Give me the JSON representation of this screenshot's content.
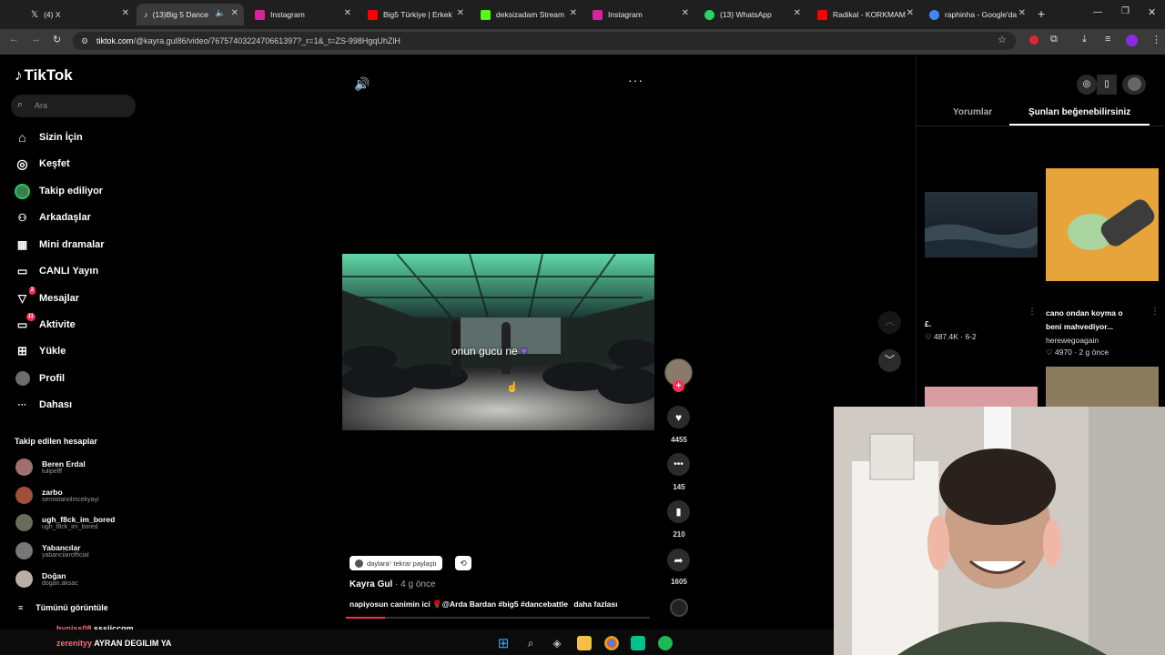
{
  "browser": {
    "tabs": [
      {
        "label": "(4) X",
        "fav": "#000000",
        "icon": "x-logo-icon"
      },
      {
        "label": "(13)Big 5 Dance",
        "fav": "#111111",
        "icon": "tiktok-icon",
        "active": true
      },
      {
        "label": "Instagram",
        "fav": "#d6249f",
        "icon": "instagram-icon"
      },
      {
        "label": "Big5 Türkiye | Erkek",
        "fav": "#ff0000",
        "icon": "youtube-icon"
      },
      {
        "label": "deksizadam Stream",
        "fav": "#53fc18",
        "icon": "kick-icon"
      },
      {
        "label": "Instagram",
        "fav": "#d6249f",
        "icon": "instagram-icon"
      },
      {
        "label": "(13) WhatsApp",
        "fav": "#25d366",
        "icon": "whatsapp-icon"
      },
      {
        "label": "Radikal - KORKMAM",
        "fav": "#ff0000",
        "icon": "youtube-icon"
      },
      {
        "label": "raphinha - Google'da",
        "fav": "#4285f4",
        "icon": "google-icon"
      }
    ],
    "url_domain": "tiktok.com",
    "url_path": "/@kayra.gul86/video/7675740322470661397?_r=1&_t=ZS-998HgqUhZlH"
  },
  "sidebar": {
    "logo": "TikTok",
    "search_placeholder": "Ara",
    "items": [
      {
        "label": "Sizin İçin",
        "icon": "home-icon",
        "glyph": "⌂"
      },
      {
        "label": "Keşfet",
        "icon": "compass-icon",
        "glyph": "◎"
      },
      {
        "label": "Takip ediliyor",
        "icon": "following-avatar-icon",
        "glyph": "●"
      },
      {
        "label": "Arkadaşlar",
        "icon": "friends-icon",
        "glyph": "👥"
      },
      {
        "label": "Mini dramalar",
        "icon": "film-icon",
        "glyph": "▦"
      },
      {
        "label": "CANLI Yayın",
        "icon": "live-tv-icon",
        "glyph": "📺"
      },
      {
        "label": "Mesajlar",
        "icon": "messages-icon",
        "glyph": "▽",
        "badge": "2"
      },
      {
        "label": "Aktivite",
        "icon": "activity-icon",
        "glyph": "▭",
        "badge": "11"
      },
      {
        "label": "Yükle",
        "icon": "upload-icon",
        "glyph": "⊞"
      },
      {
        "label": "Profil",
        "icon": "profile-icon",
        "glyph": "●"
      },
      {
        "label": "Dahası",
        "icon": "more-icon",
        "glyph": "···"
      }
    ],
    "following_title": "Takip edilen hesaplar",
    "accounts": [
      {
        "name": "Beren Erdal",
        "handle": "tulipelff",
        "color": "#a06f6f"
      },
      {
        "name": "zarbo",
        "handle": "semistanolmcekyayi",
        "color": "#a0503a"
      },
      {
        "name": "ugh_f8ck_im_bored",
        "handle": "ugh_f8ck_im_bored",
        "color": "#6b6b5a"
      },
      {
        "name": "Yabancılar",
        "handle": "yabanciiarofficial",
        "color": "#777777"
      },
      {
        "name": "Doğan",
        "handle": "dogan.aksac",
        "color": "#b8b1a3"
      }
    ],
    "view_all": "Tümünü görüntüle"
  },
  "video": {
    "overlay_text": "onun gucu ne",
    "repost_label": "daylara⁷ tekrar paylaştı",
    "author": "Kayra Gul",
    "time_ago": "· 4 g önce",
    "caption": "napiyosun canimin ici 🌹@Arda Bardan #big5 #dancebattle",
    "more_label": "daha fazlası",
    "likes": "4455",
    "comments": "145",
    "saves": "210",
    "shares": "1605",
    "progress": 0.13
  },
  "right_panel": {
    "tab_comments": "Yorumlar",
    "tab_suggested": "Şunları beğenebilirsiniz",
    "cards": [
      {
        "title": "£.",
        "stats": "♡ 487.4K · 6-2"
      },
      {
        "title": "cano ondan koyma o beni mahvediyor...",
        "author": "herewegoagain",
        "stats": "♡ 4970 · 2 g önce"
      }
    ]
  },
  "chat": [
    {
      "user": "hyniss08",
      "message": "sssiiççqm",
      "color": "#ff6a80"
    },
    {
      "user": "zerenityy",
      "message": "AYRAN DEGILIM YA",
      "color": "#ff6a80"
    }
  ],
  "colors": {
    "accent": "#fe2c55",
    "bg": "#000000"
  }
}
